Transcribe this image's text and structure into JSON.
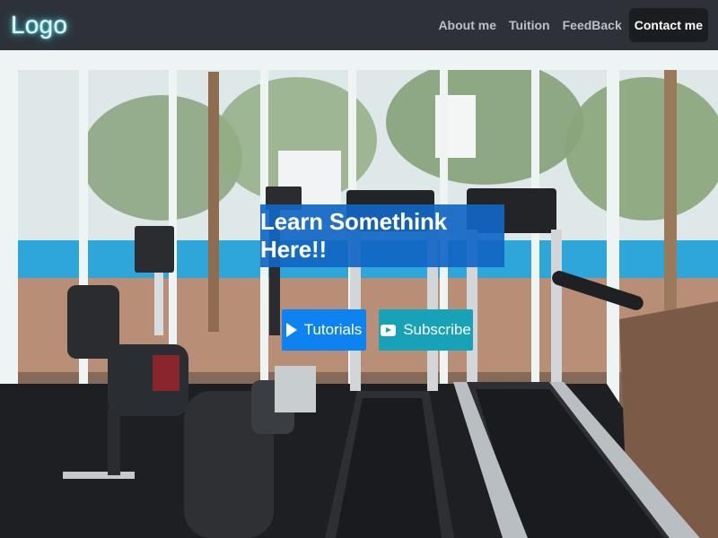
{
  "navbar": {
    "logo": "Logo",
    "links": [
      {
        "label": "About me"
      },
      {
        "label": "Tuition"
      },
      {
        "label": "FeedBack"
      },
      {
        "label": "Contact me",
        "active": true
      }
    ]
  },
  "hero": {
    "headline": "Learn Somethink Here!!",
    "buttons": {
      "tutorials": {
        "label": "Tutorials",
        "icon": "play-icon"
      },
      "subscribe": {
        "label": "Subscribe",
        "icon": "youtube-icon"
      }
    },
    "background_image": "gym-equipment-scene"
  },
  "colors": {
    "navbar_bg": "#2e3138",
    "logo_glow": "#46c6d8",
    "headline_bg": "#1166c4",
    "tutorials_bg": "#0d83f2",
    "subscribe_bg": "#17a2b8"
  }
}
